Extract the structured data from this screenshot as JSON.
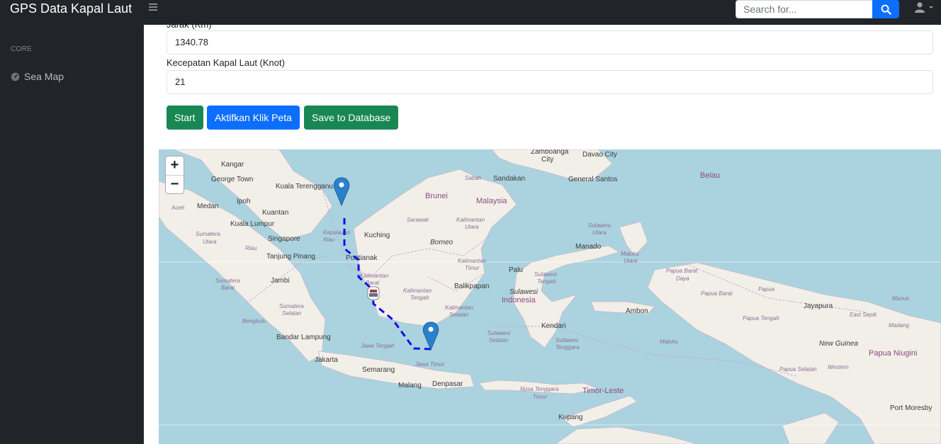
{
  "header": {
    "brand": "GPS Data Kapal Laut",
    "menu_icon": "bars-icon",
    "search_placeholder": "Search for...",
    "search_icon": "search-icon",
    "user_icon": "user-icon"
  },
  "sidebar": {
    "heading": "CORE",
    "items": [
      {
        "label": "Sea Map",
        "icon": "tachometer-icon"
      }
    ]
  },
  "form": {
    "distance_label": "Jarak (Km)",
    "distance_value": "1340.78",
    "speed_label": "Kecepatan Kapal Laut (Knot)",
    "speed_value": "21"
  },
  "buttons": {
    "start": "Start",
    "activate_click": "Aktifkan Klik Peta",
    "save": "Save to Database"
  },
  "map": {
    "zoom_in": "+",
    "zoom_out": "−",
    "labels": {
      "kangar": "Kangar",
      "george_town": "George Town",
      "kuala_terengganu": "Kuala Terengganu",
      "ipoh": "Ipoh",
      "kuantan": "Kuantan",
      "medan": "Medan",
      "aceh": "Aceh",
      "kuala_lumpur": "Kuala Lumpur",
      "singapore": "Singapore",
      "tanjung_pinang": "Tanjung Pinang",
      "kepulauan_riau": "Kepulauan Riau",
      "riau": "Riau",
      "sumatera_utara": "Sumatera Utara",
      "jambi": "Jambi",
      "sumatera_barat": "Sumatera Barat",
      "sumatera_selatan": "Sumatera Selatan",
      "bengkulu": "Bengkulu",
      "bandar_lampung": "Bandar Lampung",
      "jakarta": "Jakarta",
      "jawa_tengah": "Jawa Tengah",
      "semarang": "Semarang",
      "jawa_timur": "Jawa Timur",
      "malang": "Malang",
      "denpasar": "Denpasar",
      "kuching": "Kuching",
      "pontianak": "Pontianak",
      "kalimantan_barat": "Kalimantan Barat",
      "kalimantan_tengah": "Kalimantan Tengah",
      "kalimantan_selatan": "Kalimantan Selatan",
      "kalimantan_timur": "Kalimantan Timur",
      "kalimantan_utara": "Kalimantan Utara",
      "balikpapan": "Balikpapan",
      "borneo": "Borneo",
      "sarawak": "Sarawak",
      "brunei": "Brunei",
      "malaysia": "Malaysia",
      "sabah": "Sabah",
      "sandakan": "Sandakan",
      "zamboanga_city": "Zamboanga City",
      "davao_city": "Davao City",
      "general_santos": "General Santos",
      "belau": "Belau",
      "sulawesi_utara": "Sulawesi Utara",
      "manado": "Manado",
      "maluku_utara": "Maluku Utara",
      "palu": "Palu",
      "sulawesi_tengah": "Sulawesi Tengah",
      "sulawesi": "Sulawesi",
      "indonesia": "Indonesia",
      "sulawesi_barat": "Sulawesi Barat",
      "sulawesi_selatan": "Sulawesi Selatan",
      "kendari": "Kendari",
      "sulawesi_tenggara": "Sulawesi Tenggara",
      "ambon": "Ambon",
      "maluku": "Maluku",
      "papua_barat_daya": "Papua Barat Daya",
      "papua_barat": "Papua Barat",
      "papua": "Papua",
      "papua_tengah": "Papua Tengah",
      "jayapura": "Jayapura",
      "east_sepik": "East Sepik",
      "manus": "Manus",
      "madang": "Madang",
      "new_guinea": "New Guinea",
      "papua_niugini": "Papua Niugini",
      "papua_selatan": "Papua Selatan",
      "western": "Western",
      "port_moresby": "Port Moresby",
      "timor_leste": "Timor-Leste",
      "nusa_tenggara_timur": "Nusa Tenggara Timur",
      "kupang": "Kupang"
    },
    "marker_icon": "map-marker-icon",
    "ship_icon": "ship-icon",
    "route_color": "#1010e6"
  },
  "colors": {
    "topbar": "#212529",
    "primary": "#0d6efd",
    "success": "#198754",
    "sea": "#aad3df",
    "land": "#f2efe9"
  }
}
